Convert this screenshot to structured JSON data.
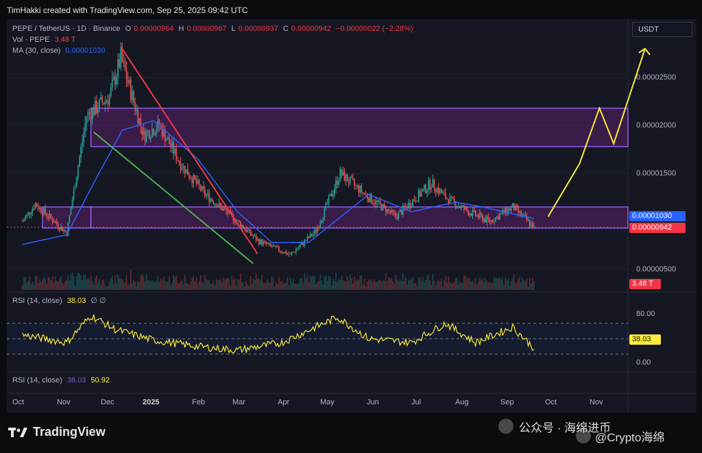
{
  "header": {
    "credit": "TimHakki created with TradingView.com, Sep 25, 2025 09:42 UTC"
  },
  "legend": {
    "symbol": "PEPE / TetherUS · 1D · Binance",
    "open_label": "O",
    "open": "0.00000964",
    "high_label": "H",
    "high": "0.00000967",
    "low_label": "L",
    "low": "0.00000937",
    "close_label": "C",
    "close": "0.00000942",
    "change": "−0.00000022 (−2.28%)",
    "vol_label": "Vol · PEPE",
    "vol_value": "3.48 T",
    "ma_label": "MA (30, close)",
    "ma_value": "0.00001030",
    "rsi1_label": "RSI (14, close)",
    "rsi1_value": "38.03",
    "rsi1_extra": "∅ ∅",
    "rsi2_label": "RSI (14, close)",
    "rsi2_value": "38.03",
    "rsi2_ma": "50.92"
  },
  "currency": "USDT",
  "price_tags": {
    "ma": "0.00001030",
    "close": "0.00000942",
    "volume": "3.48 T",
    "rsi": "38.03"
  },
  "colors": {
    "up": "#26a69a",
    "down": "#ef5350",
    "ma": "#2962ff",
    "rsi": "#ffeb3b",
    "zone": "#9c27b0",
    "red_line": "#f23645",
    "green_line": "#4caf50",
    "projection": "#ffeb3b"
  },
  "footer": {
    "brand": "TradingView",
    "watermark": "公众号 · 海绵进币",
    "watermark2": "@Crypto海绵"
  },
  "chart_data": [
    {
      "type": "candlestick",
      "title": "PEPE / TetherUS · 1D · Binance",
      "y_axis": {
        "ticks": [
          "0.00002500",
          "0.00002000",
          "0.00001500",
          "0.00000500"
        ],
        "ylim": [
          3.5e-06,
          2.9e-05
        ]
      },
      "x_axis": {
        "ticks": [
          "Oct",
          "Nov",
          "Dec",
          "2025",
          "Feb",
          "Mar",
          "Apr",
          "May",
          "Jun",
          "Jul",
          "Aug",
          "Sep",
          "Oct",
          "Nov"
        ]
      },
      "series": [
        {
          "name": "MA (30, close)",
          "type": "line",
          "x": [
            "2024-10-01",
            "2024-11-01",
            "2024-11-20",
            "2024-12-10",
            "2025-01-01",
            "2025-02-01",
            "2025-03-01",
            "2025-03-25",
            "2025-04-20",
            "2025-05-10",
            "2025-06-01",
            "2025-07-01",
            "2025-08-01",
            "2025-08-20",
            "2025-09-25"
          ],
          "values": [
            7.6e-06,
            8.6e-06,
            1.4e-05,
            1.95e-05,
            2.05e-05,
            1.65e-05,
            1.1e-05,
            7.8e-06,
            7.8e-06,
            1.02e-05,
            1.28e-05,
            1.1e-05,
            1.2e-05,
            1.15e-05,
            1.03e-05
          ]
        },
        {
          "name": "Close",
          "type": "line",
          "x": [
            "2024-10-01",
            "2024-10-10",
            "2024-11-01",
            "2024-11-15",
            "2024-12-01",
            "2024-12-09",
            "2024-12-25",
            "2025-01-05",
            "2025-01-20",
            "2025-02-05",
            "2025-02-25",
            "2025-03-15",
            "2025-04-07",
            "2025-04-25",
            "2025-05-12",
            "2025-06-01",
            "2025-06-20",
            "2025-07-15",
            "2025-07-25",
            "2025-08-10",
            "2025-08-25",
            "2025-09-10",
            "2025-09-25"
          ],
          "values": [
            1e-05,
            1.18e-05,
            8.8e-06,
            2.1e-05,
            2.3e-05,
            2.7e-05,
            1.9e-05,
            2e-05,
            1.6e-05,
            1.3e-05,
            1.05e-05,
            8e-06,
            6.5e-06,
            9e-06,
            1.5e-05,
            1.25e-05,
            1.05e-05,
            1.4e-05,
            1.25e-05,
            1.1e-05,
            1e-05,
            1.15e-05,
            9.4e-06
          ]
        }
      ],
      "zones": [
        {
          "name": "upper",
          "from": 1.78e-05,
          "to": 2.18e-05
        },
        {
          "name": "lower",
          "from": 9.3e-06,
          "to": 1.15e-05
        }
      ],
      "projection": [
        1.05e-05,
        1.6e-05,
        2.18e-05,
        1.81e-05,
        2.8e-05
      ],
      "annotations": [
        "0.00001030",
        "0.00000942",
        "3.48 T"
      ]
    },
    {
      "type": "line",
      "title": "RSI (14, close)",
      "y_axis": {
        "ticks": [
          "80.00",
          "0.00"
        ],
        "ylim": [
          0,
          100
        ]
      },
      "levels": [
        70,
        50,
        30
      ],
      "x": [
        "2024-10-01",
        "2024-11-01",
        "2024-11-18",
        "2024-12-05",
        "2025-01-01",
        "2025-02-01",
        "2025-03-01",
        "2025-04-01",
        "2025-05-10",
        "2025-06-01",
        "2025-07-01",
        "2025-07-25",
        "2025-08-15",
        "2025-09-10",
        "2025-09-25"
      ],
      "values": [
        55,
        45,
        80,
        62,
        48,
        40,
        35,
        45,
        78,
        50,
        45,
        70,
        45,
        65,
        38
      ],
      "last": "38.03"
    }
  ]
}
